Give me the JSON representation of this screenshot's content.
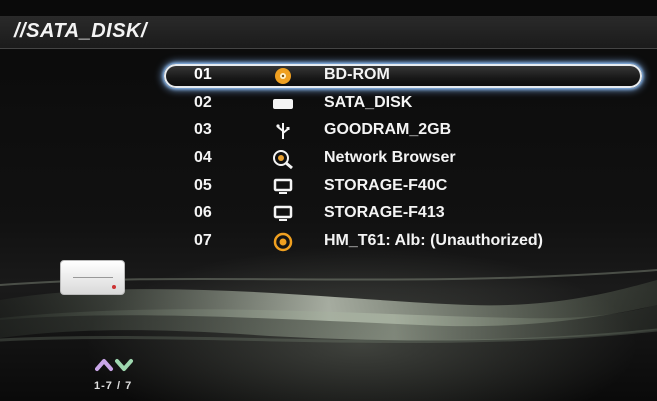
{
  "header": {
    "path": "//SATA_DISK/"
  },
  "list": {
    "items": [
      {
        "number": "01",
        "label": "BD-ROM",
        "icon": "disc-icon",
        "selected": true
      },
      {
        "number": "02",
        "label": "SATA_DISK",
        "icon": "hard-disk-icon",
        "selected": false
      },
      {
        "number": "03",
        "label": "GOODRAM_2GB",
        "icon": "usb-icon",
        "selected": false
      },
      {
        "number": "04",
        "label": "Network Browser",
        "icon": "network-search-icon",
        "selected": false
      },
      {
        "number": "05",
        "label": "STORAGE-F40C",
        "icon": "monitor-icon",
        "selected": false
      },
      {
        "number": "06",
        "label": "STORAGE-F413",
        "icon": "monitor-icon",
        "selected": false
      },
      {
        "number": "07",
        "label": "HM_T61: Alb: (Unauthorized)",
        "icon": "media-server-icon",
        "selected": false
      }
    ]
  },
  "pagination": {
    "counter": "1-7 / 7"
  },
  "colors": {
    "highlight_glow": "#9fd0ff",
    "icon_orange": "#f0a020",
    "up_arrow": "#c9a6e8",
    "down_arrow": "#9fd8b0"
  }
}
